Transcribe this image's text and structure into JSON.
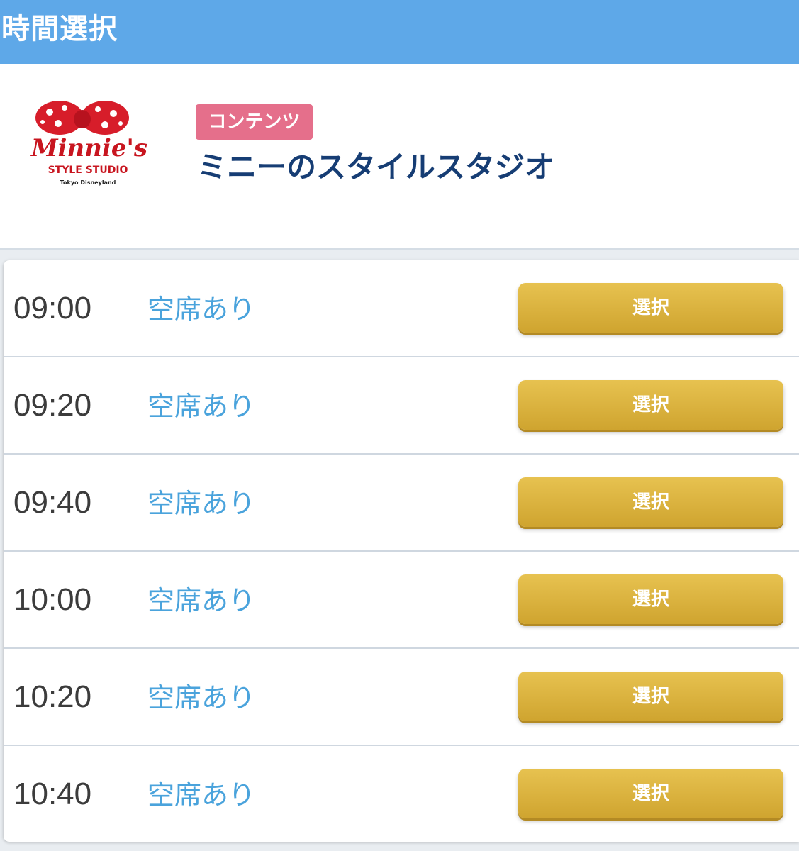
{
  "header": {
    "title": "時間選択"
  },
  "info": {
    "logo": {
      "brand_script": "Minnie's",
      "brand_line": "STYLE STUDIO",
      "brand_sub": "Tokyo Disneyland"
    },
    "badge": "コンテンツ",
    "title": "ミニーのスタイルスタジオ"
  },
  "colors": {
    "header_bg": "#5ea8e8",
    "badge_bg": "#e56f8b",
    "title_color": "#163d74",
    "status_color": "#4aa3dc",
    "button_color": "#dcb43f"
  },
  "slots": [
    {
      "time": "09:00",
      "status": "空席あり",
      "button": "選択"
    },
    {
      "time": "09:20",
      "status": "空席あり",
      "button": "選択"
    },
    {
      "time": "09:40",
      "status": "空席あり",
      "button": "選択"
    },
    {
      "time": "10:00",
      "status": "空席あり",
      "button": "選択"
    },
    {
      "time": "10:20",
      "status": "空席あり",
      "button": "選択"
    },
    {
      "time": "10:40",
      "status": "空席あり",
      "button": "選択"
    }
  ]
}
